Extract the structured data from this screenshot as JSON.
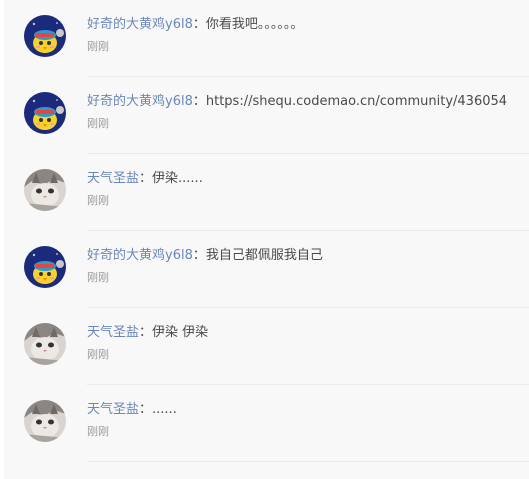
{
  "colors": {
    "username": "#6b87b8",
    "content": "#4a4a4a",
    "time": "#9b9b9b",
    "background": "#f8f8f9",
    "divider": "#e9e9ec"
  },
  "replies": [
    {
      "user": "好奇的大黄鸡y6l8",
      "separator": "：",
      "content": "你看我吧。。。。。。",
      "time": "刚刚",
      "avatar": "yellow-chick-avatar-icon"
    },
    {
      "user": "好奇的大黄鸡y6l8",
      "separator": "：",
      "content": "https://shequ.codemao.cn/community/436054",
      "time": "刚刚",
      "avatar": "yellow-chick-avatar-icon"
    },
    {
      "user": "天气圣盐",
      "separator": "：",
      "content": "伊染......",
      "time": "刚刚",
      "avatar": "cat-photo-avatar-icon"
    },
    {
      "user": "好奇的大黄鸡y6l8",
      "separator": "：",
      "content": "我自己都佩服我自己",
      "time": "刚刚",
      "avatar": "yellow-chick-avatar-icon"
    },
    {
      "user": "天气圣盐",
      "separator": "：",
      "content": "伊染 伊染",
      "time": "刚刚",
      "avatar": "cat-photo-avatar-icon"
    },
    {
      "user": "天气圣盐",
      "separator": "：",
      "content": "......",
      "time": "刚刚",
      "avatar": "cat-photo-avatar-icon"
    }
  ]
}
